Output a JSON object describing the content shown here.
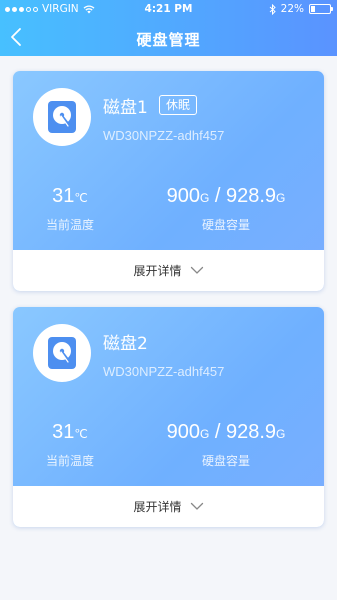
{
  "status_bar": {
    "carrier": "VIRGIN",
    "time": "4:21 PM",
    "battery": "22%",
    "battery_level": 0.22
  },
  "header": {
    "title": "硬盘管理",
    "back_icon": "chevron-left-icon"
  },
  "disks": [
    {
      "name": "磁盘1",
      "badge": "休眠",
      "model": "WD30NPZZ-adhf457",
      "temperature": "31",
      "temperature_unit": "℃",
      "temperature_label": "当前温度",
      "used": "900",
      "used_unit": "G",
      "separator": " / ",
      "total": "928.9",
      "total_unit": "G",
      "capacity_label": "硬盘容量",
      "expand_label": "展开详情"
    },
    {
      "name": "磁盘2",
      "model": "WD30NPZZ-adhf457",
      "temperature": "31",
      "temperature_unit": "℃",
      "temperature_label": "当前温度",
      "used": "900",
      "used_unit": "G",
      "separator": " / ",
      "total": "928.9",
      "total_unit": "G",
      "capacity_label": "硬盘容量",
      "expand_label": "展开详情"
    }
  ],
  "colors": {
    "header_start": "#47c0ff",
    "header_end": "#5a93ff",
    "card_accent": "#6fb0ff",
    "disk_icon": "#4d8ff0"
  }
}
